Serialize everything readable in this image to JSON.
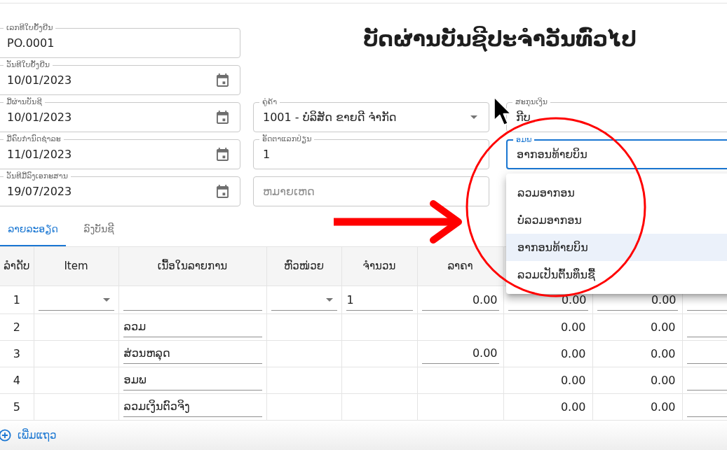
{
  "title": "ບັດຜ່ານບັນຊີປະຈຳວັນທົ່ວໄປ",
  "left_fields": [
    {
      "kind": "text",
      "label": "ເລກທີໃບຍັ້ງຢືນ",
      "value": "PO.0001",
      "focused": false
    },
    {
      "kind": "date",
      "label": "ວັນທີໃບຍັ້ງຢືນ",
      "value": "10/01/2023",
      "focused": false
    },
    {
      "kind": "date",
      "label": "ມື້ຜ່ານບັນຊີ",
      "value": "10/01/2023",
      "focused": false
    },
    {
      "kind": "date",
      "label": "ມື້ຄົບກຳນົດຊຳລະ",
      "value": "11/01/2023",
      "focused": false
    },
    {
      "kind": "date",
      "label": "ວັນທີມື້ລົງເອກະສານ",
      "value": "19/07/2023",
      "focused": false
    }
  ],
  "middle_fields": [
    {
      "kind": "select",
      "label": "ຄູ່ຄ້າ",
      "value": "1001 - ບໍລິສັດ ຂາຍດີ ຈຳກັດ",
      "focused": false
    },
    {
      "kind": "text",
      "label": "ອັດຕາແລກປ່ຽນ",
      "value": "1",
      "focused": false
    },
    {
      "kind": "text",
      "placeholder": "ຫມາຍເຫດ",
      "focused": false
    }
  ],
  "right_fields": [
    {
      "kind": "text",
      "label": "ສະກຸນເງິນ",
      "value": "ກີບ",
      "focused": false
    },
    {
      "kind": "text",
      "label": "ອມພ",
      "value": "ອາກອນທ້າຍບິນ",
      "focused": true
    }
  ],
  "dropdown_menu": {
    "items": [
      {
        "label": "ລວມອາກອນ",
        "selected": false
      },
      {
        "label": "ບໍ່ລວມອາກອນ",
        "selected": false
      },
      {
        "label": "ອາກອນທ້າຍບິນ",
        "selected": true
      },
      {
        "label": "ລວມເປັນຕົ້ນທຶນຊື້",
        "selected": false
      }
    ]
  },
  "tabs": [
    {
      "label": "ລາຍລະອຽດ",
      "selected": true
    },
    {
      "label": "ລົງບັນຊີ",
      "selected": false
    }
  ],
  "table": {
    "columns": [
      "ລຳດັບ",
      "Item",
      "ເນື້ອໃນລາຍການ",
      "ຫົວໜ່ວຍ",
      "ຈຳນວນ",
      "ລາຄາ"
    ],
    "rows": [
      {
        "cells": [
          {
            "kind": "index",
            "value": "1"
          },
          {
            "kind": "select"
          },
          {
            "kind": "input"
          },
          {
            "kind": "select"
          },
          {
            "kind": "input",
            "value": "1"
          },
          {
            "kind": "amount_input",
            "value": "0.00"
          },
          {
            "kind": "amount_input",
            "value": "0.00"
          },
          {
            "kind": "amount_input",
            "value": "0.00"
          },
          {
            "kind": "input"
          }
        ]
      },
      {
        "cells": [
          {
            "kind": "index",
            "value": "2"
          },
          {
            "kind": "empty"
          },
          {
            "kind": "input",
            "value": "ລວມ"
          },
          {
            "kind": "empty"
          },
          {
            "kind": "empty"
          },
          {
            "kind": "empty"
          },
          {
            "kind": "amount",
            "value": "0.00"
          },
          {
            "kind": "amount",
            "value": "0.00"
          },
          {
            "kind": "input"
          }
        ]
      },
      {
        "cells": [
          {
            "kind": "index",
            "value": "3"
          },
          {
            "kind": "empty"
          },
          {
            "kind": "input",
            "value": "ສ່ວນຫລຸດ"
          },
          {
            "kind": "empty"
          },
          {
            "kind": "empty"
          },
          {
            "kind": "amount_input",
            "value": "0.00"
          },
          {
            "kind": "amount",
            "value": "0.00"
          },
          {
            "kind": "amount",
            "value": "0.00"
          },
          {
            "kind": "input"
          }
        ]
      },
      {
        "cells": [
          {
            "kind": "index",
            "value": "4"
          },
          {
            "kind": "empty"
          },
          {
            "kind": "input",
            "value": "ອມພ"
          },
          {
            "kind": "empty"
          },
          {
            "kind": "empty"
          },
          {
            "kind": "empty"
          },
          {
            "kind": "amount",
            "value": "0.00"
          },
          {
            "kind": "amount",
            "value": "0.00"
          },
          {
            "kind": "input"
          }
        ]
      },
      {
        "cells": [
          {
            "kind": "index",
            "value": "5"
          },
          {
            "kind": "empty"
          },
          {
            "kind": "input",
            "value": "ລວມເງິນຕົວຈິງ"
          },
          {
            "kind": "empty"
          },
          {
            "kind": "empty"
          },
          {
            "kind": "empty"
          },
          {
            "kind": "amount",
            "value": "0.00"
          },
          {
            "kind": "amount",
            "value": "0.00"
          },
          {
            "kind": "input"
          }
        ]
      }
    ]
  },
  "add_row_button": {
    "label": "ເພີ່ມແຖວ"
  }
}
